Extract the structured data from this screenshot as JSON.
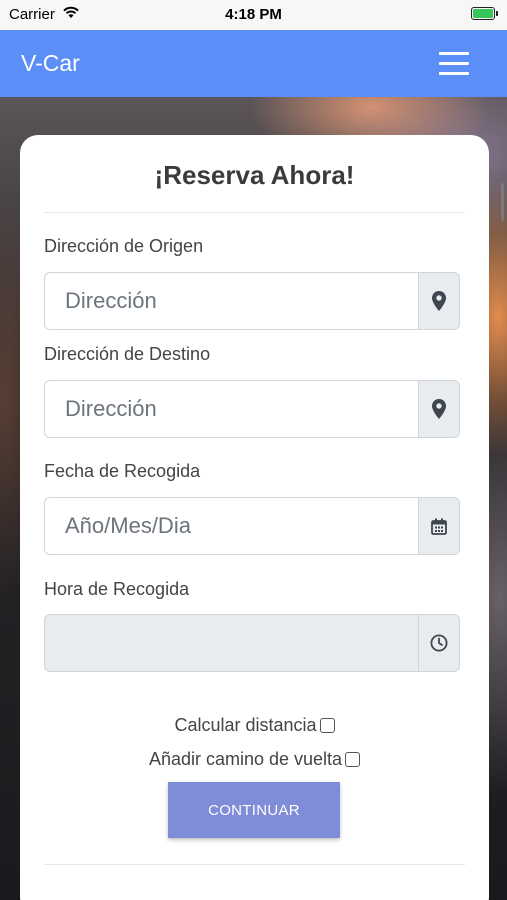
{
  "status_bar": {
    "carrier": "Carrier",
    "time": "4:18 PM"
  },
  "navbar": {
    "brand": "V-Car"
  },
  "form": {
    "title": "¡Reserva Ahora!",
    "origin": {
      "label": "Dirección de Origen",
      "placeholder": "Dirección",
      "value": ""
    },
    "destination": {
      "label": "Dirección de Destino",
      "placeholder": "Dirección",
      "value": ""
    },
    "pickup_date": {
      "label": "Fecha de Recogida",
      "placeholder": "Año/Mes/Dia",
      "value": ""
    },
    "pickup_time": {
      "label": "Hora de Recogida",
      "value": ""
    },
    "calc_distance_label": "Calcular distancia",
    "return_trip_label": "Añadir camino de vuelta",
    "continue_label": "CONTINUAR"
  },
  "colors": {
    "navbar": "#5b8ff7",
    "button": "#7f8cd8",
    "addon": "#e9ecef"
  },
  "icons": {
    "origin_addon": "map-pin-icon",
    "destination_addon": "map-pin-icon",
    "date_addon": "calendar-icon",
    "time_addon": "clock-icon"
  }
}
